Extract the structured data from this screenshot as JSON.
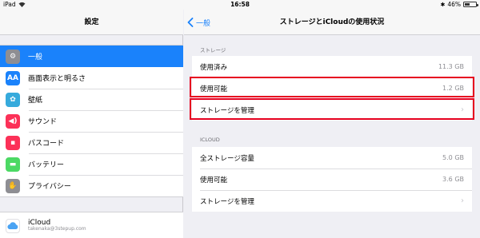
{
  "status_bar": {
    "device": "iPad",
    "time": "16:58",
    "battery": "46%",
    "battery_level": 0.46
  },
  "sidebar": {
    "title": "設定",
    "items": [
      {
        "label": "一般",
        "icon": "gear-icon",
        "color": "#8e8e93",
        "glyph": "⚙"
      },
      {
        "label": "画面表示と明るさ",
        "icon": "display-icon",
        "color": "#1a82fb",
        "glyph": "AA"
      },
      {
        "label": "壁紙",
        "icon": "wallpaper-icon",
        "color": "#36aadc",
        "glyph": "✿"
      },
      {
        "label": "サウンド",
        "icon": "sound-icon",
        "color": "#fc3158",
        "glyph": "◀)"
      },
      {
        "label": "パスコード",
        "icon": "passcode-icon",
        "color": "#fc3158",
        "glyph": "▪"
      },
      {
        "label": "バッテリー",
        "icon": "battery-icon",
        "color": "#4cd964",
        "glyph": "▬"
      },
      {
        "label": "プライバシー",
        "icon": "privacy-hand-icon",
        "color": "#8e8e93",
        "glyph": "✋"
      }
    ],
    "icloud": {
      "title": "iCloud",
      "subtitle": "takenaka@3stepup.com",
      "icon": "icloud-icon",
      "color": "#ffffff"
    }
  },
  "detail": {
    "back_label": "一般",
    "title": "ストレージとiCloudの使用状況",
    "storage_header": "ストレージ",
    "storage_rows": [
      {
        "label": "使用済み",
        "value": "11.3 GB"
      },
      {
        "label": "使用可能",
        "value": "1.2 GB"
      },
      {
        "label": "ストレージを管理"
      }
    ],
    "icloud_header": "ICLOUD",
    "icloud_rows": [
      {
        "label": "全ストレージ容量",
        "value": "5.0 GB"
      },
      {
        "label": "使用可能",
        "value": "3.6 GB"
      },
      {
        "label": "ストレージを管理"
      }
    ]
  },
  "colors": {
    "accent": "#1a82fb",
    "highlight": "#e6001f"
  }
}
